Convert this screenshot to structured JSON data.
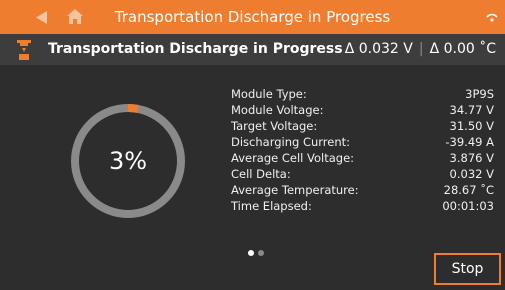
{
  "topbar": {
    "title": "Transportation Discharge in Progress",
    "back_icon": "back-triangle-icon",
    "home_icon": "home-icon",
    "status_icon": "wifi-icon"
  },
  "header": {
    "title": "Transportation Discharge in Progress",
    "voltage_delta": "Δ 0.032 V",
    "separator": "|",
    "temperature_delta": "Δ 0.00 ˚C",
    "icon": "discharge-icon"
  },
  "gauge": {
    "progress_percent": 3,
    "label": "3%"
  },
  "details": [
    {
      "label": "Module Type:",
      "value": "3P9S"
    },
    {
      "label": "Module Voltage:",
      "value": "34.77 V"
    },
    {
      "label": "Target Voltage:",
      "value": "31.50 V"
    },
    {
      "label": "Discharging Current:",
      "value": "-39.49 A"
    },
    {
      "label": "Average Cell Voltage:",
      "value": "3.876 V"
    },
    {
      "label": "Cell Delta:",
      "value": "0.032 V"
    },
    {
      "label": "Average Temperature:",
      "value": "28.67 ˚C"
    },
    {
      "label": "Time Elapsed:",
      "value": "00:01:03"
    }
  ],
  "pager": {
    "total_pages": 2,
    "active_page": 1
  },
  "actions": {
    "stop_label": "Stop"
  },
  "colors": {
    "accent": "#ee7d2f",
    "background": "#2d2d2d",
    "header_bg": "#3d3d3d",
    "gauge_track": "#8a8a8a",
    "gauge_fill": "#ee7d2f"
  }
}
